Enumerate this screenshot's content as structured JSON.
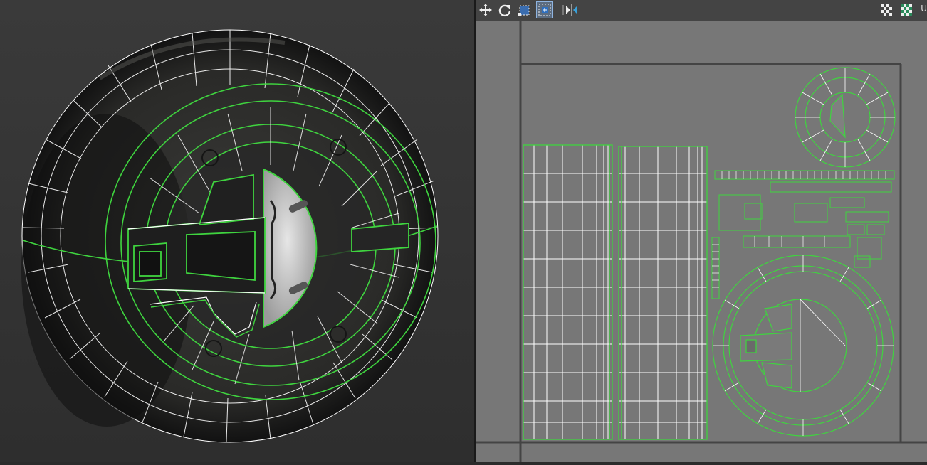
{
  "viewport": {
    "name": "3d-viewport"
  },
  "uv_editor": {
    "toolbar": {
      "tools": [
        {
          "id": "move",
          "icon": "move-icon"
        },
        {
          "id": "rotate",
          "icon": "rotate-icon"
        },
        {
          "id": "freeform",
          "icon": "freeform-icon"
        },
        {
          "id": "select",
          "icon": "select-mode-icon",
          "active": true
        },
        {
          "id": "mirror",
          "icon": "mirror-icon"
        }
      ],
      "right_tools": [
        {
          "id": "checker",
          "icon": "checker-pattern-icon"
        },
        {
          "id": "texture",
          "icon": "texture-icon"
        }
      ],
      "truncated_label": "U"
    }
  },
  "colors": {
    "wire_selected": "#3fd43f",
    "wire": "#ffffff",
    "uv_background": "#777777"
  }
}
